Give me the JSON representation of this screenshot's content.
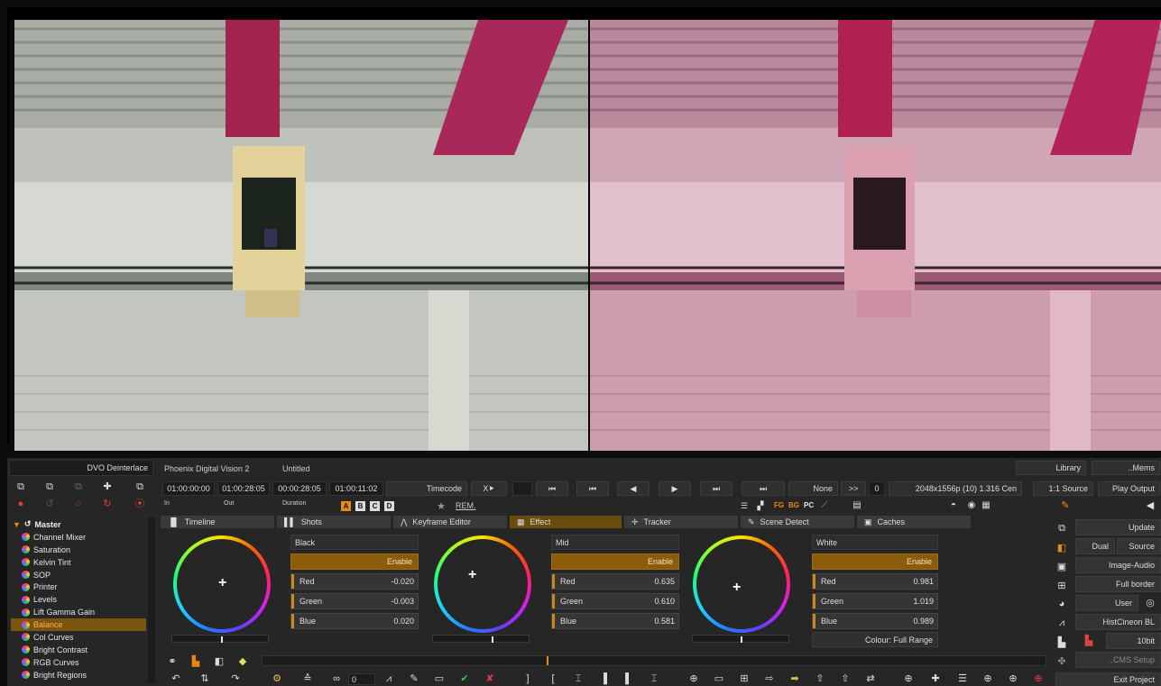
{
  "app": {
    "plugin_name": "DVO Deinterlace",
    "title": "Phoenix Digital Vision 2",
    "project": "Untitled"
  },
  "timecodes": {
    "in_value": "01:00:00:00",
    "out_value": "01:00:28:05",
    "duration_value": "00:00:28:05",
    "current": "01:00:11:02",
    "in_label": "In",
    "out_label": "Out",
    "duration_label": "Duration",
    "mode": "Timecode"
  },
  "transport": {
    "none_label": "None",
    "skip_label": ">>",
    "frame_value": "0",
    "format": "2048x1556p (10) 1.316 Cen",
    "ratio": "1:1 Source",
    "play_output": "Play Output"
  },
  "top_right": {
    "library": "Library",
    "mems": "..Mems"
  },
  "versions": [
    "A",
    "B",
    "C",
    "D"
  ],
  "rem_label": "REM.",
  "indicators": {
    "fg": "FG",
    "bg": "BG",
    "pc": "PC"
  },
  "tabs": [
    {
      "label": "Timeline",
      "icon": "timeline-icon"
    },
    {
      "label": "Shots",
      "icon": "shots-icon"
    },
    {
      "label": "Keyframe Editor",
      "icon": "keyframe-icon"
    },
    {
      "label": "Effect",
      "icon": "effect-icon"
    },
    {
      "label": "Tracker",
      "icon": "tracker-icon"
    },
    {
      "label": "Scene Detect",
      "icon": "scene-icon"
    },
    {
      "label": "Caches",
      "icon": "caches-icon"
    }
  ],
  "tree": {
    "root": "Master",
    "items": [
      "Channel Mixer",
      "Saturation",
      "Kelvin Tint",
      "SOP",
      "Printer",
      "Levels",
      "Lift Gamma Gain",
      "Balance",
      "Col Curves",
      "Bright Contrast",
      "RGB Curves",
      "Bright Regions"
    ],
    "selected": "Balance"
  },
  "balance": {
    "enable_label": "Enable",
    "black": {
      "title": "Black",
      "red_label": "Red",
      "red": "-0.020",
      "green_label": "Green",
      "green": "-0.003",
      "blue_label": "Blue",
      "blue": "0.020"
    },
    "mid": {
      "title": "Mid",
      "red_label": "Red",
      "red": "0.635",
      "green_label": "Green",
      "green": "0.610",
      "blue_label": "Blue",
      "blue": "0.581"
    },
    "white": {
      "title": "White",
      "red_label": "Red",
      "red": "0.981",
      "green_label": "Green",
      "green": "1.019",
      "blue_label": "Blue",
      "blue": "0.989"
    },
    "colour_mode": "Colour: Full Range"
  },
  "right_panel": {
    "update": "Update",
    "dual": "Dual",
    "source": "Source",
    "image_audio": "Image-Audio",
    "full_border": "Full border",
    "user": "User",
    "hist": "HistCineon BL",
    "bit": "10bit",
    "cms": "..CMS Setup",
    "exit": "Exit Project"
  },
  "bottom": {
    "counter": "0"
  },
  "colors": {
    "accent": "#c98a18",
    "selected": "#7a5410",
    "background": "#262626"
  }
}
